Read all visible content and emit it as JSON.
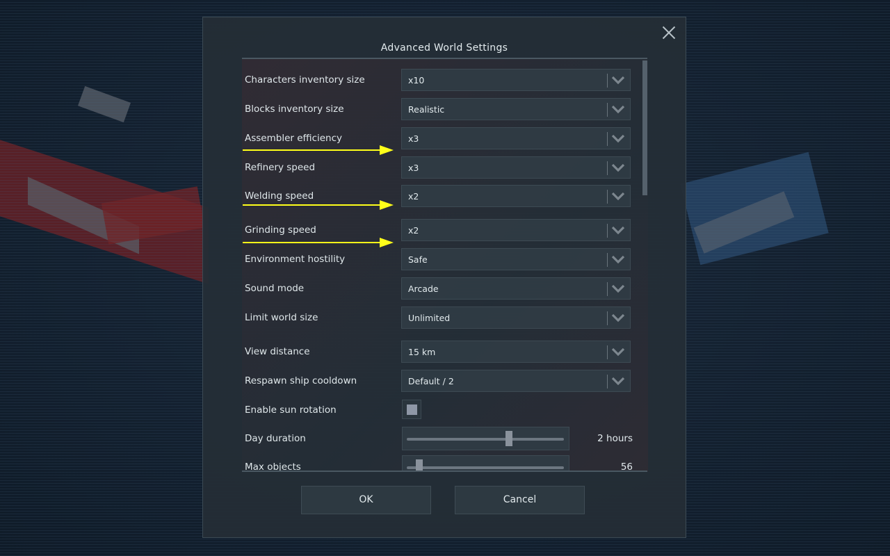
{
  "dialog": {
    "title": "Advanced World Settings",
    "close_icon": "close-icon"
  },
  "settings": [
    {
      "label": "Characters inventory size",
      "type": "combo",
      "value": "x10"
    },
    {
      "label": "Blocks inventory size",
      "type": "combo",
      "value": "Realistic"
    },
    {
      "label": "Assembler efficiency",
      "type": "combo",
      "value": "x3"
    },
    {
      "label": "Refinery speed",
      "type": "combo",
      "value": "x3"
    },
    {
      "label": "Welding speed",
      "type": "combo",
      "value": "x2"
    },
    {
      "label": "Grinding speed",
      "type": "combo",
      "value": "x2"
    },
    {
      "label": "Environment hostility",
      "type": "combo",
      "value": "Safe"
    },
    {
      "label": "Sound mode",
      "type": "combo",
      "value": "Arcade"
    },
    {
      "label": "Limit world size",
      "type": "combo",
      "value": "Unlimited"
    },
    {
      "label": "View distance",
      "type": "combo",
      "value": "15 km"
    },
    {
      "label": "Respawn ship cooldown",
      "type": "combo",
      "value": "Default / 2"
    },
    {
      "label": "Enable sun rotation",
      "type": "checkbox",
      "checked": true
    },
    {
      "label": "Day duration",
      "type": "slider",
      "value_text": "2 hours",
      "fraction": 0.65
    },
    {
      "label": "Max objects",
      "type": "slider",
      "value_text": "56",
      "fraction": 0.08
    }
  ],
  "annotations": {
    "arrow_color": "#ffff1a",
    "arrows_point_to": [
      "Assembler efficiency",
      "Welding speed",
      "Grinding speed"
    ]
  },
  "scrollbar": {
    "position_fraction": 0.0
  },
  "buttons": {
    "ok": "OK",
    "cancel": "Cancel"
  }
}
